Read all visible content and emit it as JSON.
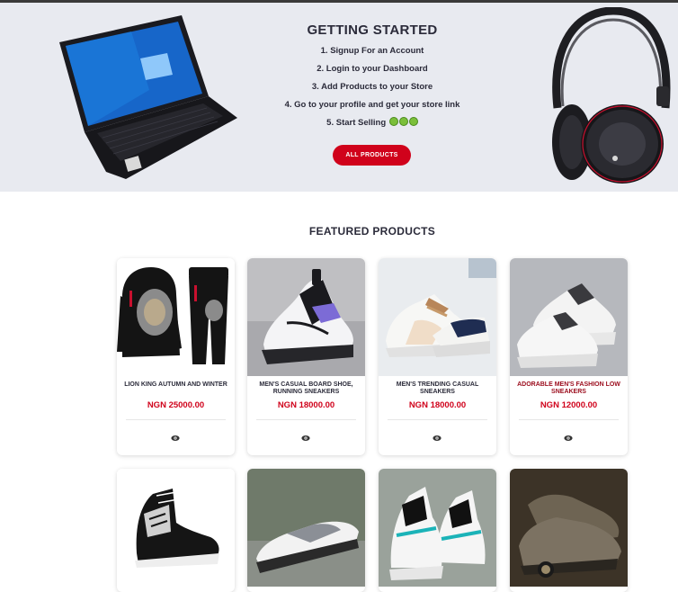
{
  "hero": {
    "title": "GETTING STARTED",
    "steps": [
      "1. Signup For an Account",
      "2. Login to your Dashboard",
      "3. Add Products to your Store",
      "4. Go to your profile and get your store link",
      "5. Start Selling"
    ],
    "emoji": [
      "money-mouth-face",
      "money-mouth-face",
      "money-mouth-face"
    ],
    "all_products_label": "ALL PRODUCTS"
  },
  "featured": {
    "title": "FEATURED PRODUCTS",
    "products": [
      {
        "name": "LION KING AUTUMN AND WINTER",
        "price": "NGN 25000.00",
        "image": "hoodie-tracksuit"
      },
      {
        "name": "MEN'S CASUAL BOARD SHOE, RUNNING SNEAKERS",
        "price": "NGN 18000.00",
        "image": "white-purple-sneaker"
      },
      {
        "name": "MEN'S TRENDING CASUAL SNEAKERS",
        "price": "NGN 18000.00",
        "image": "white-navy-sneaker"
      },
      {
        "name": "ADORABLE MEN'S FASHION LOW SNEAKERS",
        "price": "NGN 12000.00",
        "image": "white-grey-sneaker"
      },
      {
        "name": "",
        "price": "",
        "image": "black-high-top-sneaker"
      },
      {
        "name": "",
        "price": "",
        "image": "white-loafer"
      },
      {
        "name": "",
        "price": "",
        "image": "teal-black-sneaker"
      },
      {
        "name": "",
        "price": "",
        "image": "brown-boot"
      }
    ]
  },
  "colors": {
    "accent": "#d0021b",
    "hero_bg": "#e8eaf0",
    "heading": "#2b2b3a"
  }
}
